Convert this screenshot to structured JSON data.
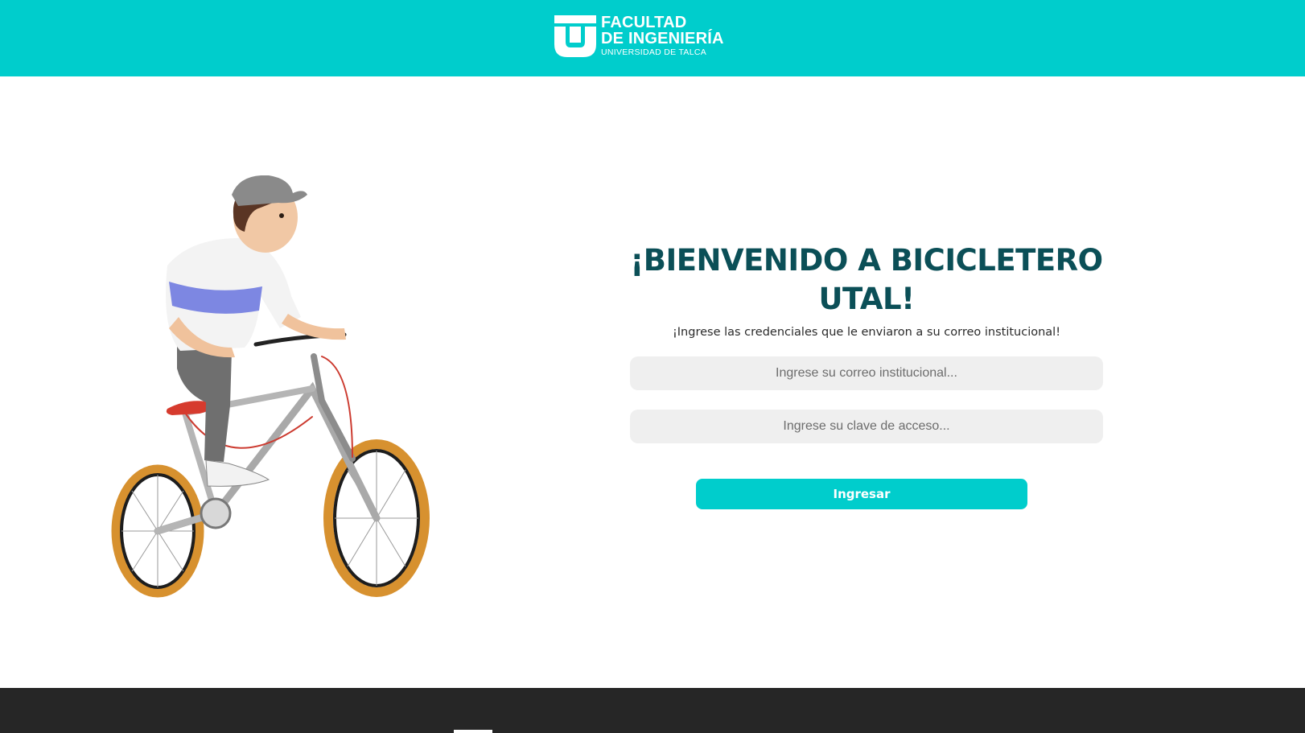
{
  "colors": {
    "brand": "#00cdcc",
    "title": "#0b4f57",
    "footer": "#262626"
  },
  "header": {
    "logo": {
      "line1": "FACULTAD",
      "line2": "DE INGENIERÍA",
      "line3": "UNIVERSIDAD DE TALCA",
      "icon": "university-logo-icon"
    }
  },
  "hero": {
    "illustration": "cyclist-illustration"
  },
  "login": {
    "title": "¡BIENVENIDO A BICICLETERO UTAL!",
    "subtitle": "¡Ingrese las credenciales que le enviaron a su correo institucional!",
    "email_placeholder": "Ingrese su correo institucional...",
    "password_placeholder": "Ingrese su clave de acceso...",
    "submit_label": "Ingresar"
  }
}
